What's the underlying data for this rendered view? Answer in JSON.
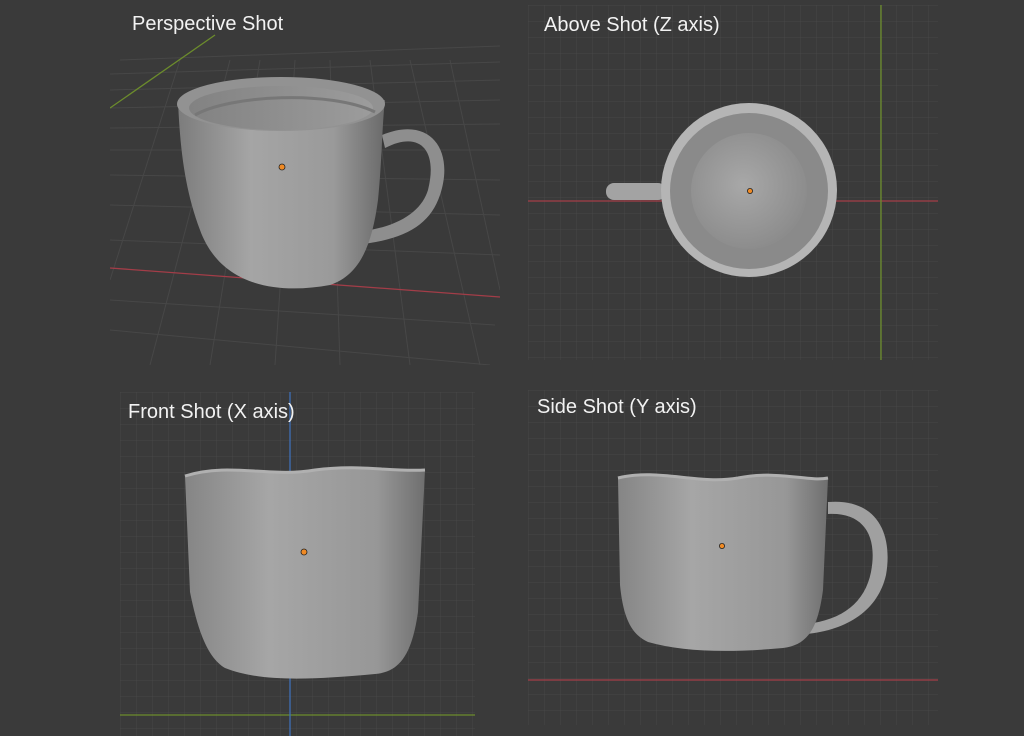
{
  "viewports": {
    "perspective": {
      "label": "Perspective Shot"
    },
    "top": {
      "label": "Above Shot (Z axis)"
    },
    "front": {
      "label": "Front Shot (X axis)"
    },
    "side": {
      "label": "Side Shot (Y axis)"
    }
  },
  "colors": {
    "background": "#3a3a3a",
    "x_axis": "#a33d48",
    "y_axis": "#6c8c2c",
    "z_axis": "#3f6fb5",
    "origin": "#f08a24",
    "cup": "#9a9a9a"
  }
}
